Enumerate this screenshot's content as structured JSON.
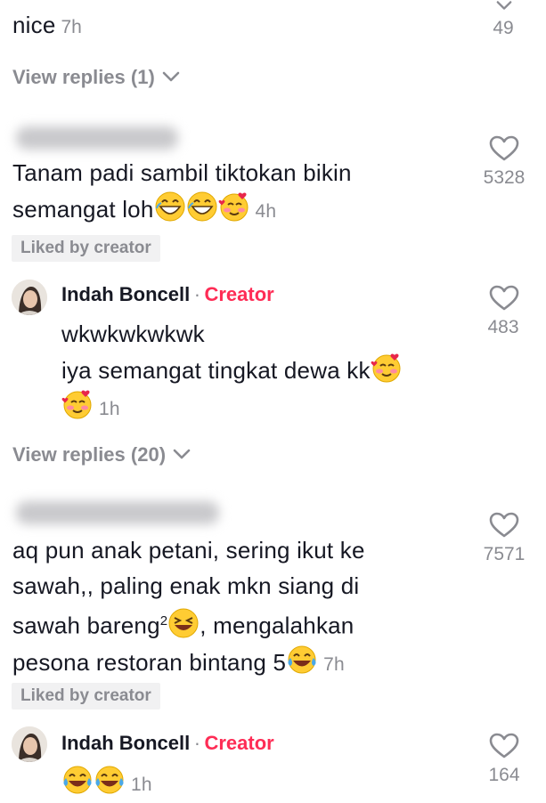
{
  "c1": {
    "text": "nice",
    "time": "7h",
    "likes": "49"
  },
  "replies1": {
    "label": "View replies (1)"
  },
  "c2": {
    "line1": "Tanam padi sambil tiktokan bikin",
    "line2": "semangat loh",
    "time": "4h",
    "likes": "5328",
    "badge": "Liked by creator"
  },
  "r1": {
    "author": "Indah Boncell",
    "sep": "·",
    "role": "Creator",
    "line1": "wkwkwkwkwk",
    "line2": "iya semangat tingkat dewa kk",
    "time": "1h",
    "likes": "483"
  },
  "replies2": {
    "label": "View replies (20)"
  },
  "c3": {
    "line1": "aq pun anak petani, sering ikut ke",
    "line2": "sawah,, paling enak mkn siang di",
    "line3a": "sawah bareng",
    "line3sup": "2",
    "line3b": ", mengalahkan",
    "line4": "pesona restoran bintang 5",
    "time": "7h",
    "likes": "7571",
    "badge": "Liked by creator"
  },
  "r2": {
    "author": "Indah Boncell",
    "sep": "·",
    "role": "Creator",
    "time": "1h",
    "likes": "164"
  },
  "icons": {
    "heart": "heart-outline-icon",
    "chevron": "chevron-down-icon"
  },
  "colors": {
    "creator": "#fe2c55",
    "muted": "#8a8b91",
    "text": "#161823"
  }
}
